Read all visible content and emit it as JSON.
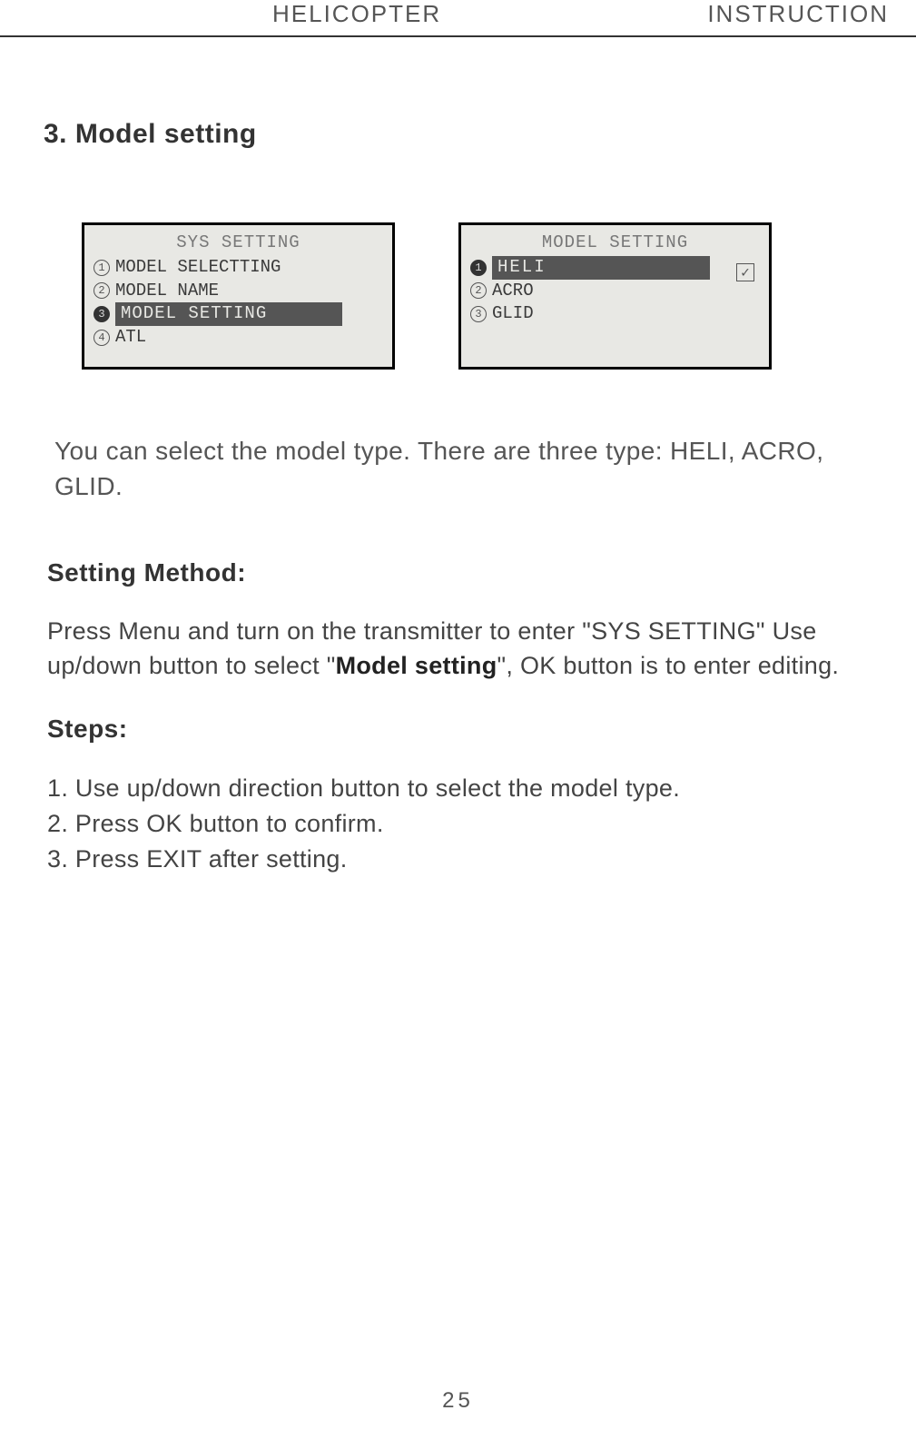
{
  "header": {
    "left": "HELICOPTER",
    "right": "INSTRUCTION"
  },
  "section_title": "3. Model setting",
  "screen1": {
    "title": "SYS SETTING",
    "items": [
      {
        "n": "1",
        "label": "MODEL SELECTTING",
        "selected": false
      },
      {
        "n": "2",
        "label": "MODEL NAME",
        "selected": false
      },
      {
        "n": "3",
        "label": "MODEL SETTING",
        "selected": true
      },
      {
        "n": "4",
        "label": "ATL",
        "selected": false
      }
    ]
  },
  "screen2": {
    "title": "MODEL SETTING",
    "items": [
      {
        "n": "1",
        "label": "HELI",
        "selected": true
      },
      {
        "n": "2",
        "label": "ACRO",
        "selected": false
      },
      {
        "n": "3",
        "label": "GLID",
        "selected": false
      }
    ],
    "check": "✓"
  },
  "intro": "You can select the model type. There are three type: HELI, ACRO, GLID.",
  "setting_method_heading": "Setting Method:",
  "setting_method_body_pre": "Press Menu and turn on the transmitter to enter \"SYS SETTING\" Use up/down button to select \"",
  "setting_method_bold": "Model setting",
  "setting_method_body_post": "\", OK button is to enter editing.",
  "steps_heading": "Steps:",
  "steps": [
    "1. Use up/down direction button to select the model type.",
    "2. Press OK button to confirm.",
    "3. Press EXIT after setting."
  ],
  "page_number": "25"
}
